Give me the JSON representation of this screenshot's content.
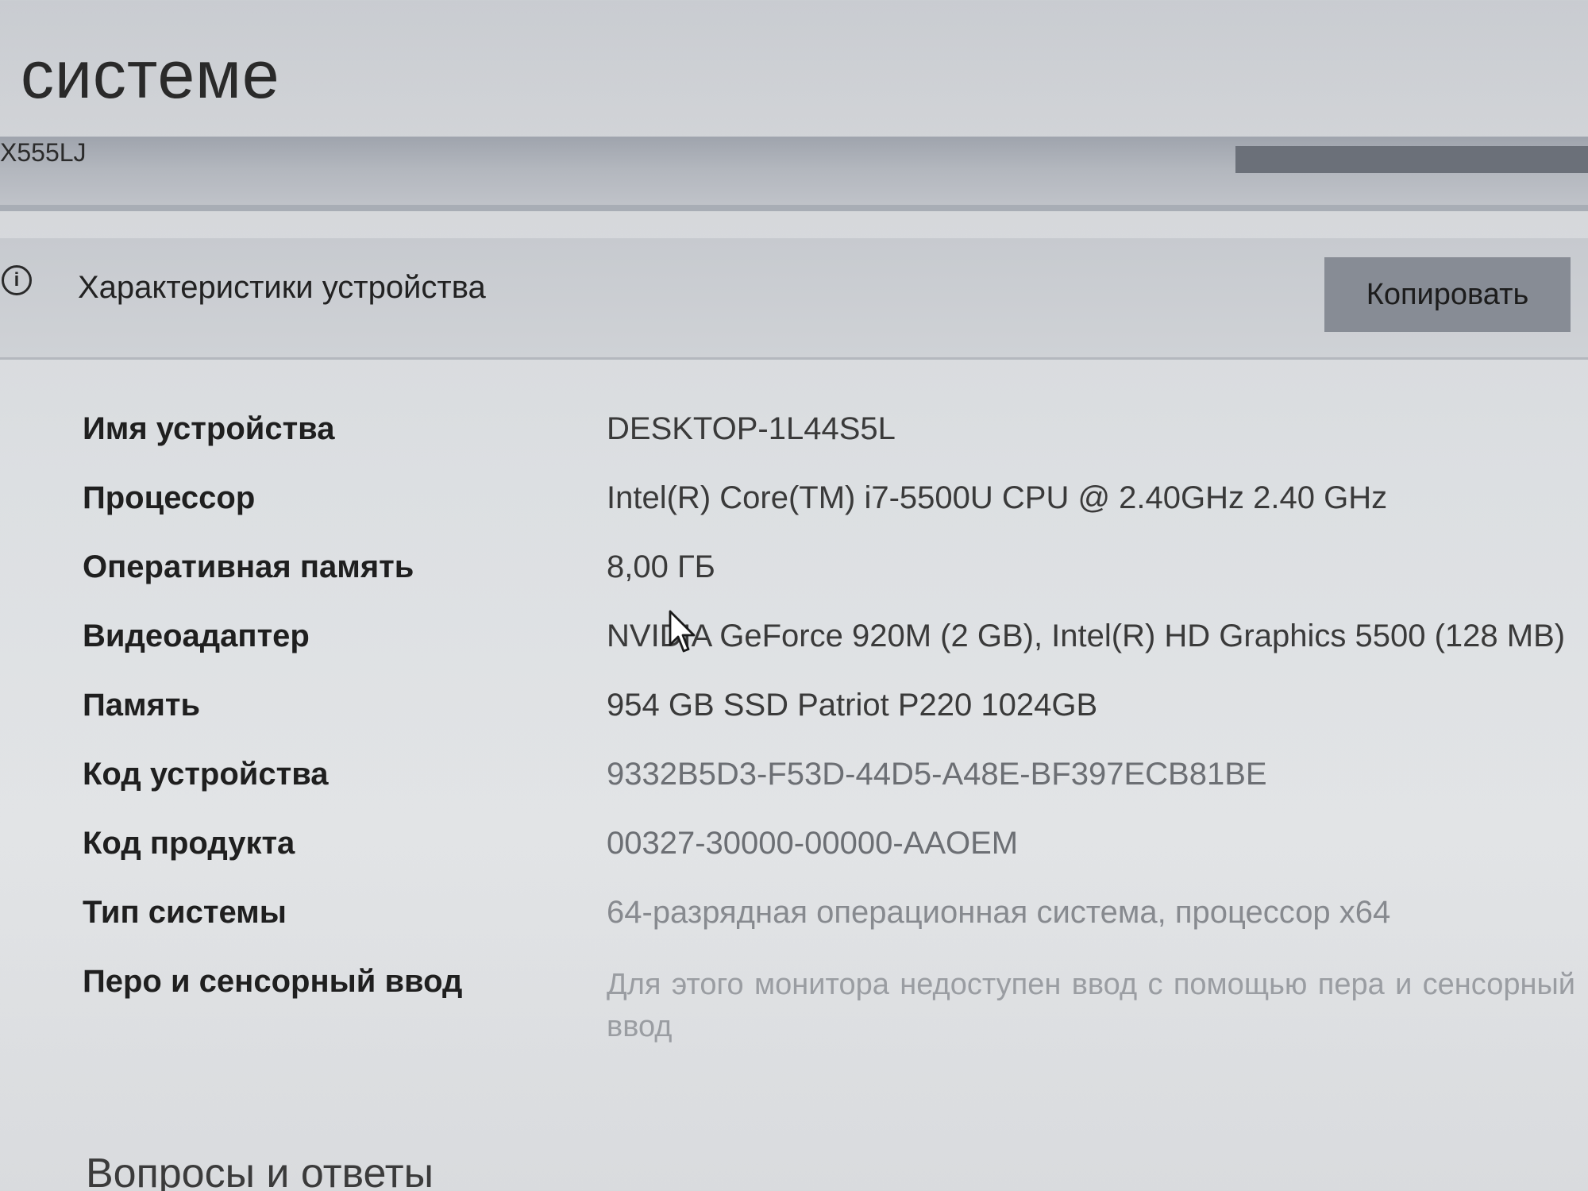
{
  "header": {
    "title": "системе",
    "model": "X555LJ"
  },
  "device_specs": {
    "title": "Характеристики устройства",
    "copy_label": "Копировать",
    "rows": [
      {
        "label": "Имя устройства",
        "value": "DESKTOP-1L44S5L"
      },
      {
        "label": "Процессор",
        "value": "Intel(R) Core(TM) i7-5500U CPU @ 2.40GHz   2.40 GHz"
      },
      {
        "label": "Оперативная память",
        "value": "8,00 ГБ"
      },
      {
        "label": "Видеоадаптер",
        "value": "NVIDIA GeForce 920M (2 GB), Intel(R) HD Graphics 5500 (128 MB)"
      },
      {
        "label": "Память",
        "value": "954 GB SSD Patriot P220 1024GB"
      },
      {
        "label": "Код устройства",
        "value": "9332B5D3-F53D-44D5-A48E-BF397ECB81BE"
      },
      {
        "label": "Код продукта",
        "value": "00327-30000-00000-AAOEM"
      },
      {
        "label": "Тип системы",
        "value": "64-разрядная операционная система, процессор x64"
      },
      {
        "label": "Перо и сенсорный ввод",
        "value": "Для этого монитора недоступен ввод с помощью пера и сенсорный ввод"
      }
    ]
  },
  "faq": {
    "title": "Вопросы и ответы"
  },
  "icons": {
    "info": "info-icon",
    "cursor": "mouse-pointer-icon"
  }
}
